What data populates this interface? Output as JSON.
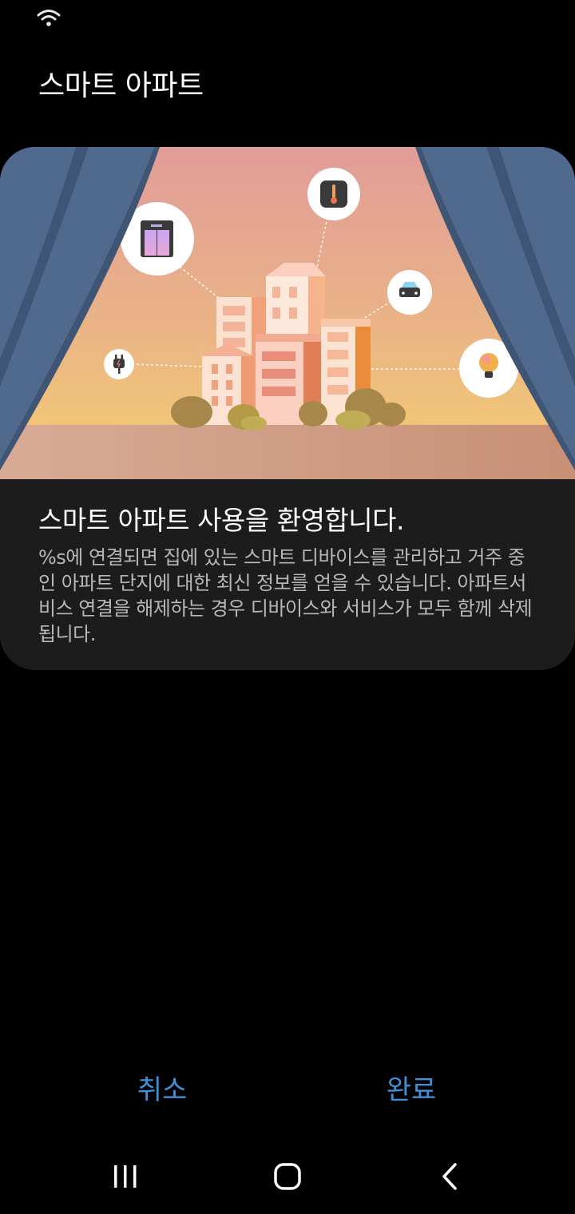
{
  "status_bar": {
    "wifi_icon": "wifi-icon"
  },
  "header": {
    "title": "스마트 아파트"
  },
  "card": {
    "title": "스마트 아파트 사용을 환영합니다.",
    "description": " %s에 연결되면 집에 있는 스마트 디바이스를 관리하고 거주 중인 아파트 단지에 대한 최신 정보를 얻을 수 있습니다. 아파트서비스 연결을 해제하는 경우 디바이스와 서비스가 모두 함께 삭제됩니다.",
    "illustration_icons": [
      "elevator-icon",
      "thermometer-icon",
      "car-icon",
      "plug-icon",
      "lightbulb-icon"
    ]
  },
  "actions": {
    "cancel_label": "취소",
    "done_label": "완료",
    "accent": "#3e91d9"
  },
  "nav_bar": {
    "icons": [
      "recent-apps-icon",
      "home-icon",
      "back-icon"
    ]
  }
}
